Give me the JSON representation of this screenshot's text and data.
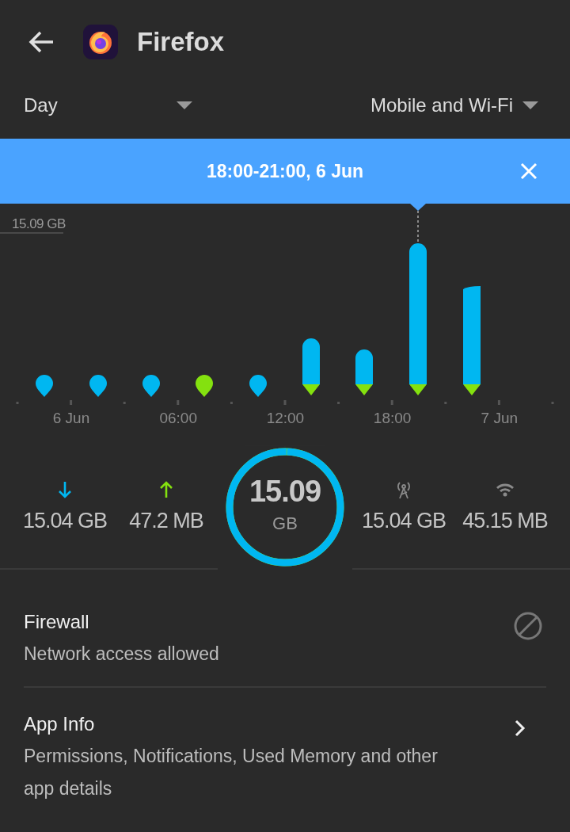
{
  "header": {
    "title": "Firefox"
  },
  "filters": [
    {
      "label": "Day"
    },
    {
      "label": "Mobile and Wi-Fi"
    }
  ],
  "banner": {
    "text": "18:00-21:00, 6 Jun"
  },
  "chart": {
    "max_label": "15.09 GB",
    "x_labels": [
      "6 Jun",
      "06:00",
      "12:00",
      "18:00",
      "7 Jun"
    ]
  },
  "stats": [
    {
      "kind": "download",
      "value": "15.04 GB"
    },
    {
      "kind": "upload",
      "value": "47.2 MB"
    },
    {
      "kind": "mobile",
      "value": "15.04 GB"
    },
    {
      "kind": "wifi",
      "value": "45.15 MB"
    }
  ],
  "total": {
    "value": "15.09",
    "unit": "GB",
    "level": 0.997
  },
  "settings": [
    {
      "kind": "blocked",
      "title": "Firewall",
      "subtitle": "Network access allowed"
    },
    {
      "kind": "link",
      "title": "App Info",
      "subtitle": "Permissions, Notifications, Used Memory and other app details"
    }
  ]
}
